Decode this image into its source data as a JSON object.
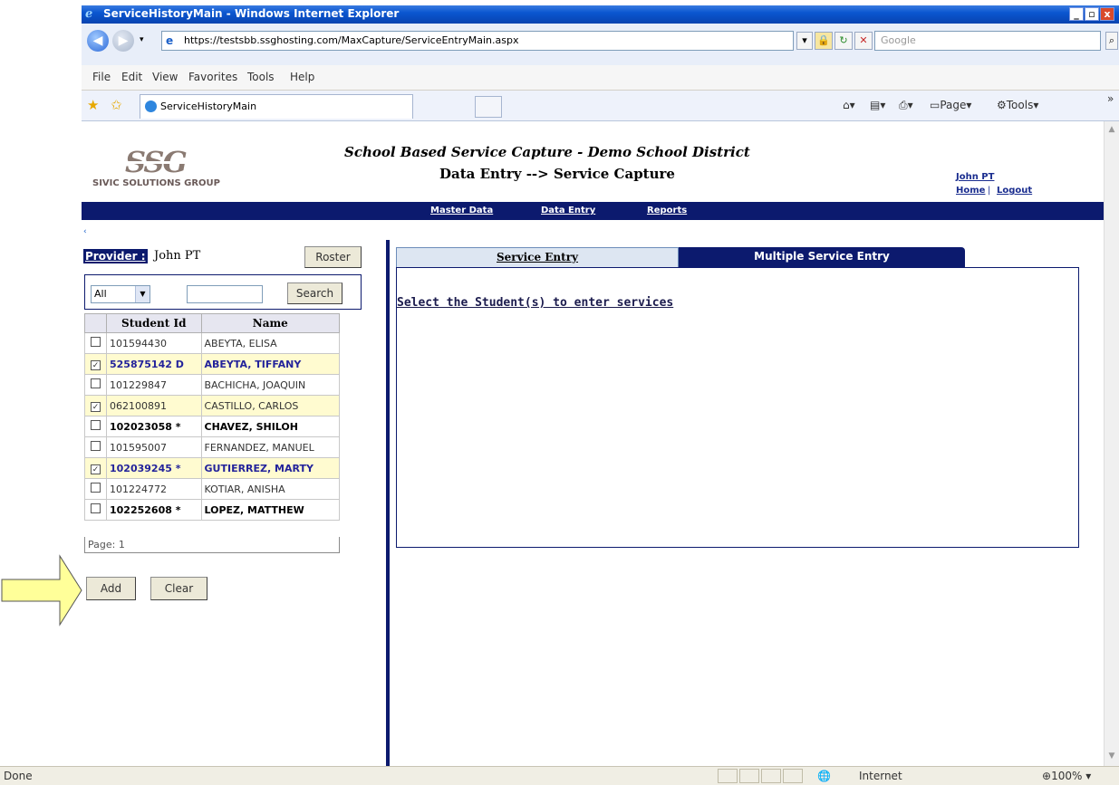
{
  "window": {
    "title": "ServiceHistoryMain - Windows Internet Explorer",
    "url": "https://testsbb.ssghosting.com/MaxCapture/ServiceEntryMain.aspx",
    "search_placeholder": "Google",
    "menu": [
      "File",
      "Edit",
      "View",
      "Favorites",
      "Tools",
      "Help"
    ],
    "tab_title": "ServiceHistoryMain",
    "commands": {
      "page": "Page",
      "tools": "Tools"
    }
  },
  "header": {
    "logo_text": "SSG",
    "logo_sub": "SIVIC SOLUTIONS GROUP",
    "title": "School Based Service Capture - Demo School District",
    "subtitle": "Data Entry --> Service Capture",
    "user": "John PT",
    "home": "Home",
    "separator": "|",
    "logout": "Logout"
  },
  "nav": {
    "items": [
      "Master Data",
      "Data Entry",
      "Reports"
    ],
    "collapse": "‹"
  },
  "left": {
    "provider_label": "Provider :",
    "provider_name": "John PT",
    "roster_button": "Roster",
    "filter_value": "All",
    "search_button": "Search",
    "columns": [
      "Student Id",
      "Name"
    ],
    "rows": [
      {
        "id": "101594430",
        "name": "ABEYTA, ELISA",
        "checked": false,
        "bold": false
      },
      {
        "id": "525875142 D",
        "name": "ABEYTA, TIFFANY",
        "checked": true,
        "bold": true
      },
      {
        "id": "101229847",
        "name": "BACHICHA, JOAQUIN",
        "checked": false,
        "bold": false
      },
      {
        "id": "062100891",
        "name": "CASTILLO, CARLOS",
        "checked": true,
        "bold": false
      },
      {
        "id": "102023058 *",
        "name": "CHAVEZ, SHILOH",
        "checked": false,
        "bold": true
      },
      {
        "id": "101595007",
        "name": "FERNANDEZ, MANUEL",
        "checked": false,
        "bold": false
      },
      {
        "id": "102039245 *",
        "name": "GUTIERREZ, MARTY",
        "checked": true,
        "bold": true
      },
      {
        "id": "101224772",
        "name": "KOTIAR, ANISHA",
        "checked": false,
        "bold": false
      },
      {
        "id": "102252608 *",
        "name": "LOPEZ, MATTHEW",
        "checked": false,
        "bold": true
      }
    ],
    "pager": "Page: 1",
    "add_button": "Add",
    "clear_button": "Clear"
  },
  "right": {
    "tabs": [
      "Service Entry",
      "Multiple Service Entry"
    ],
    "instruction": "Select the Student(s) to enter services"
  },
  "status": {
    "left": "Done",
    "zone": "Internet",
    "zoom": "100%"
  },
  "colors": {
    "navy": "#0c1a6e",
    "arrow_fill": "#ffff99",
    "selected_row": "#fffbd0"
  }
}
